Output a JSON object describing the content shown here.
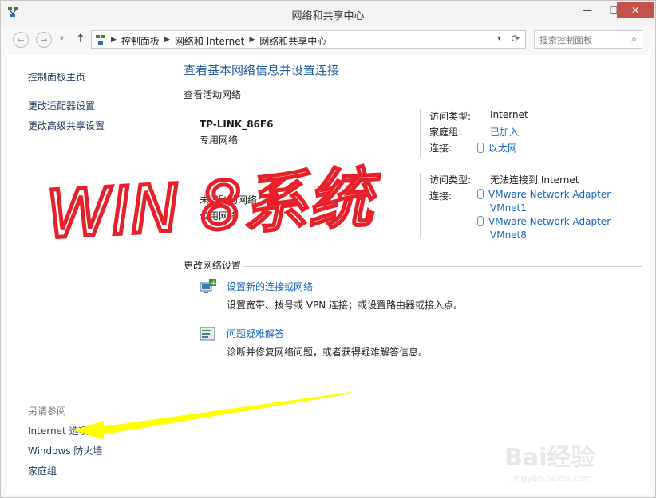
{
  "window": {
    "title": "网络和共享中心",
    "minimize": "—",
    "maximize": "☐",
    "close": "✕"
  },
  "nav": {
    "back": "←",
    "forward": "→",
    "dropdown": "▾",
    "up": "↑",
    "breadcrumbs": [
      "控制面板",
      "网络和 Internet",
      "网络和共享中心"
    ],
    "search_placeholder": "搜索控制面板"
  },
  "left": {
    "home": "控制面板主页",
    "adapter": "更改适配器设置",
    "sharing": "更改高级共享设置",
    "see_also": "另请参阅",
    "internet_options": "Internet 选项",
    "firewall": "Windows 防火墙",
    "homegroup": "家庭组"
  },
  "main": {
    "heading": "查看基本网络信息并设置连接",
    "active_networks": "查看活动网络",
    "net1": {
      "name": "TP-LINK_86F6",
      "type": "专用网络",
      "access_label": "访问类型:",
      "access_value": "Internet",
      "homegroup_label": "家庭组:",
      "homegroup_value": "已加入",
      "conn_label": "连接:",
      "conn_value": "以太网"
    },
    "net2": {
      "name": "未识别的网络",
      "type": "公用网络",
      "access_label": "访问类型:",
      "access_value": "无法连接到 Internet",
      "conn_label": "连接:",
      "conn_value1a": "VMware Network Adapter",
      "conn_value1b": "VMnet1",
      "conn_value2a": "VMware Network Adapter",
      "conn_value2b": "VMnet8"
    },
    "change_settings": "更改网络设置",
    "task1": {
      "link": "设置新的连接或网络",
      "desc": "设置宽带、拨号或 VPN 连接；或设置路由器或接入点。"
    },
    "task2": {
      "link": "问题疑难解答",
      "desc": "诊断并修复网络问题，或者获得疑难解答信息。"
    }
  },
  "annotation": {
    "text": "WIN 8系统",
    "color": "#e8202a",
    "arrow_color": "#ffff00"
  },
  "watermark": {
    "brand": "Bai经验",
    "url": "jingyan.baidu.com"
  }
}
